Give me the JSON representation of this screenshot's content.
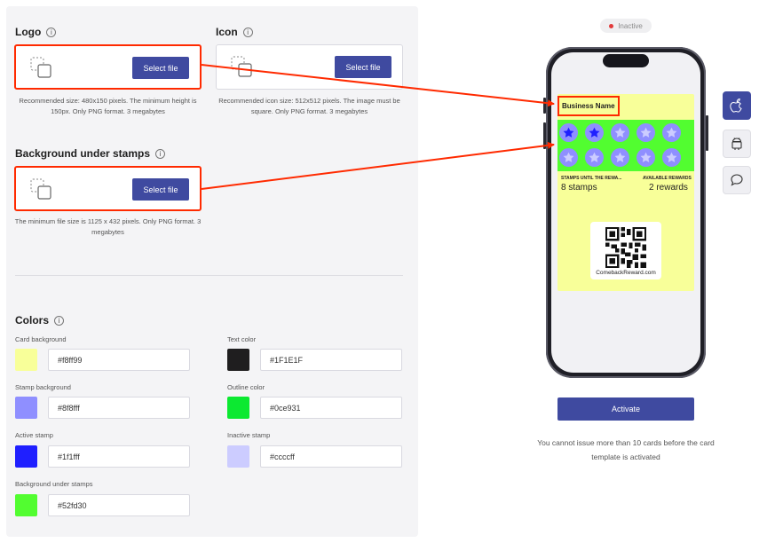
{
  "left": {
    "logo": {
      "title": "Logo",
      "button": "Select file",
      "hint": "Recommended size: 480x150 pixels. The minimum height is 150px. Only PNG format. 3 megabytes"
    },
    "icon": {
      "title": "Icon",
      "button": "Select file",
      "hint": "Recommended icon size: 512x512 pixels. The image must be square. Only PNG format. 3 megabytes"
    },
    "background": {
      "title": "Background under stamps",
      "button": "Select file",
      "hint": "The minimum file size is 1125 x 432 pixels. Only PNG format. 3 megabytes"
    },
    "colors": {
      "title": "Colors",
      "items": [
        {
          "label": "Card background",
          "value": "#f8ff99",
          "swatch": "#f8ff99"
        },
        {
          "label": "Text color",
          "value": "#1F1E1F",
          "swatch": "#1f1e1f"
        },
        {
          "label": "Stamp background",
          "value": "#8f8fff",
          "swatch": "#8f8fff"
        },
        {
          "label": "Outline color",
          "value": "#0ce931",
          "swatch": "#0ce931"
        },
        {
          "label": "Active stamp",
          "value": "#1f1fff",
          "swatch": "#1f1fff"
        },
        {
          "label": "Inactive stamp",
          "value": "#ccccff",
          "swatch": "#ccccff"
        },
        {
          "label": "Background under stamps",
          "value": "#52fd30",
          "swatch": "#52fd30"
        }
      ]
    }
  },
  "preview": {
    "status": "Inactive",
    "business_name": "Business Name",
    "stamps_label": "STAMPS UNTIL THE REWA...",
    "stamps_value": "8 stamps",
    "rewards_label": "AVAILABLE REWARDS",
    "rewards_value": "2 rewards",
    "qr_caption": "ComebackReward.com",
    "stamps_total": 10,
    "stamps_active": 2
  },
  "actions": {
    "activate": "Activate",
    "note": "You cannot issue more than 10 cards before the card template is activated"
  },
  "platforms": [
    {
      "icon": "apple-icon"
    },
    {
      "icon": "android-icon"
    },
    {
      "icon": "chat-icon"
    }
  ],
  "colors": {
    "accent": "#3f4aa0",
    "highlight": "#ff2a00"
  }
}
